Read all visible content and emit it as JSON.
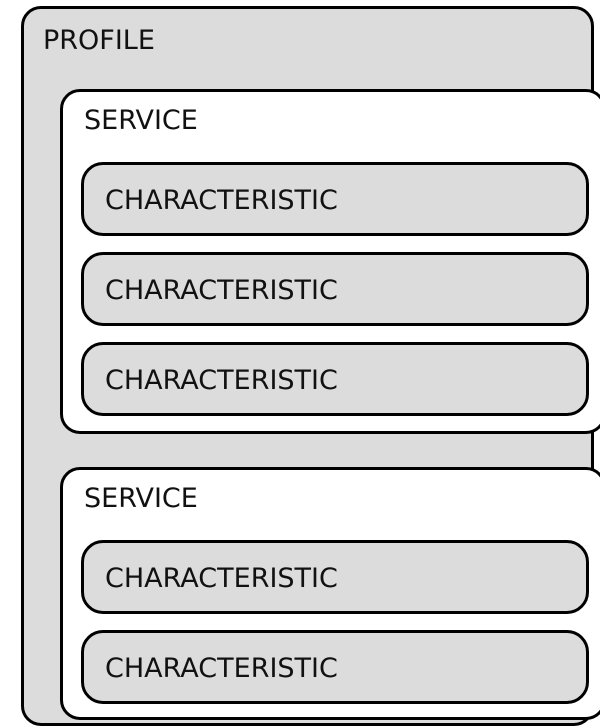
{
  "profile": {
    "label": "PROFILE",
    "services": [
      {
        "label": "SERVICE",
        "characteristics": [
          "CHARACTERISTIC",
          "CHARACTERISTIC",
          "CHARACTERISTIC"
        ]
      },
      {
        "label": "SERVICE",
        "characteristics": [
          "CHARACTERISTIC",
          "CHARACTERISTIC"
        ]
      }
    ]
  },
  "colors": {
    "outline": "#000000",
    "profile_fill": "#dcdcdc",
    "service_fill": "#ffffff",
    "characteristic_fill": "#dcdcdc"
  }
}
